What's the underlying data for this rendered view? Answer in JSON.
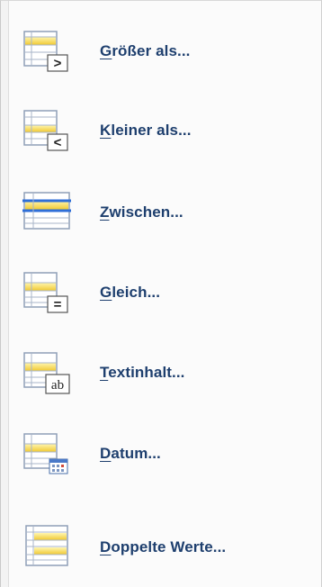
{
  "menu": {
    "items": [
      {
        "hotkey": "G",
        "rest": "rößer als...",
        "icon": "greater-than-icon"
      },
      {
        "hotkey": "K",
        "rest": "leiner als...",
        "icon": "less-than-icon"
      },
      {
        "hotkey": "Z",
        "rest": "wischen...",
        "icon": "between-icon"
      },
      {
        "hotkey": "G",
        "rest": "leich...",
        "icon": "equal-to-icon"
      },
      {
        "hotkey": "T",
        "rest": "extinhalt...",
        "icon": "text-contains-icon"
      },
      {
        "hotkey": "D",
        "rest": "atum...",
        "icon": "date-occurring-icon"
      },
      {
        "hotkey": "D",
        "rest": "oppelte Werte...",
        "icon": "duplicate-values-icon"
      }
    ],
    "symbols": {
      "greater": ">",
      "less": "<",
      "equal": "=",
      "text": "ab"
    }
  }
}
